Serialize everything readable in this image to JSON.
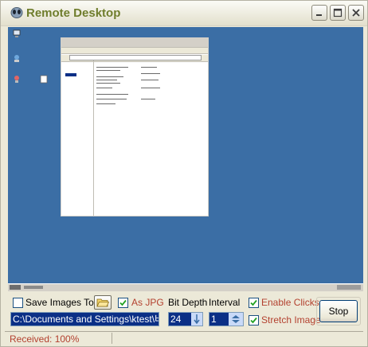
{
  "window": {
    "title": "Remote Desktop",
    "accent": "#6f7d2c",
    "icons": [
      "alien-app-icon",
      "minimize-icon",
      "maximize-icon",
      "close-icon"
    ]
  },
  "remote_screen": {
    "background": "#3b6ea5",
    "icons": [
      "my-computer-icon",
      "recycle-bin-icon",
      "network-icon",
      "file-icon"
    ]
  },
  "controls": {
    "save_images_label": "Save Images To",
    "save_images_checked": false,
    "as_jpg_label": "As JPG",
    "as_jpg_checked": true,
    "bit_depth_label": "Bit Depth",
    "bit_depth_value": "24",
    "interval_label": "Interval",
    "interval_value": "1",
    "enable_clicks_label": "Enable Clicks",
    "enable_clicks_checked": true,
    "stretch_image_label": "Stretch Image",
    "stretch_image_checked": true,
    "path_value": "C:\\Documents and Settings\\ktest\\바탕",
    "stop_label": "Stop"
  },
  "status": {
    "text": "Received: 100%"
  }
}
